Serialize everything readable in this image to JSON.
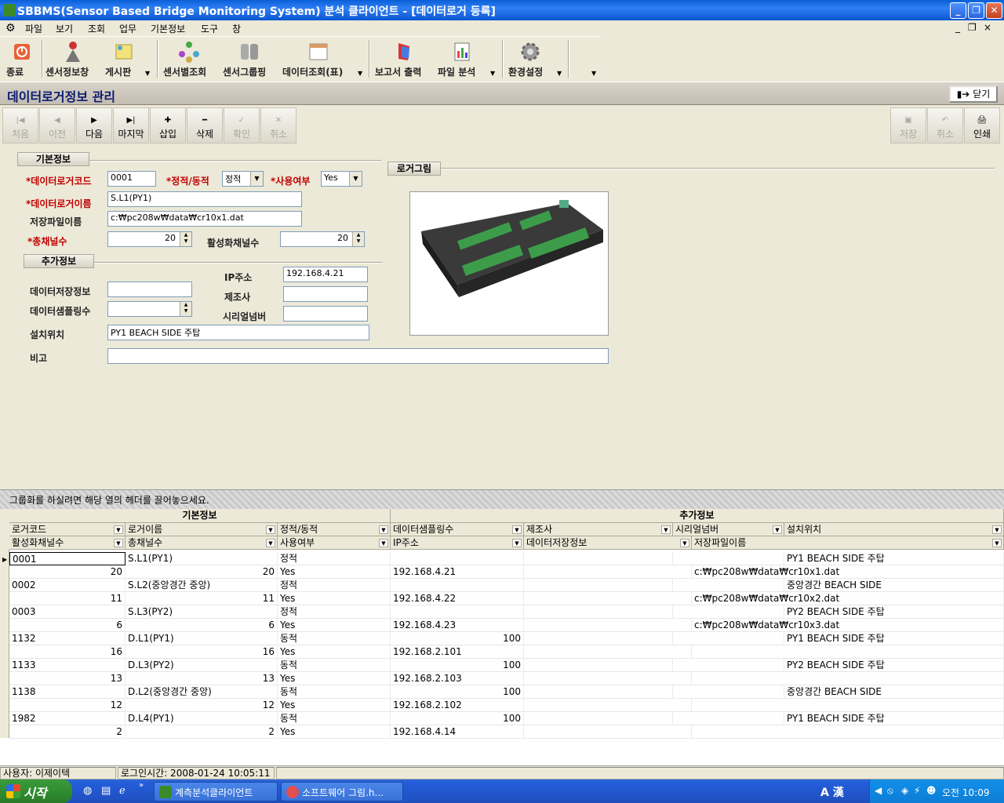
{
  "window": {
    "title": "SBBMS(Sensor Based Bridge Monitoring System) 분석 클라이언트 - [데이터로거 등록]",
    "min": "_",
    "max": "❐",
    "close": "✕"
  },
  "menu": [
    "파일",
    "보기",
    "조회",
    "업무",
    "기본정보",
    "도구",
    "창"
  ],
  "mdi_controls": [
    "_",
    "❐",
    "×"
  ],
  "toolbar": {
    "exit": "종료",
    "sensor_info": "센서정보창",
    "board": "게시판",
    "sensor_query": "센서별조회",
    "sensor_group": "센서그룹핑",
    "data_query": "데이터조회(표)",
    "report": "보고서 출력",
    "file_analysis": "파일 분석",
    "settings": "환경설정"
  },
  "form": {
    "title": "데이터로거정보 관리",
    "close_label": "닫기"
  },
  "nav": {
    "first": "처음",
    "prev": "이전",
    "next": "다음",
    "last": "마지막",
    "insert": "삽입",
    "delete": "삭제",
    "confirm": "확인",
    "cancel": "취소",
    "save": "저장",
    "cancel2": "취소",
    "print": "인쇄"
  },
  "sections": {
    "basic": "기본정보",
    "extra": "추가정보",
    "photo": "로거그림"
  },
  "labels": {
    "logger_code": "*데이터로거코드",
    "static_dynamic": "*정적/동적",
    "in_use": "*사용여부",
    "logger_name": "*데이터로거이름",
    "save_file": "저장파일이름",
    "total_channels": "*총채널수",
    "active_channels": "활성화채널수",
    "ip": "IP주소",
    "data_store": "데이터저장정보",
    "maker": "제조사",
    "sampling": "데이터샘플링수",
    "serial": "시리얼넘버",
    "location": "설치위치",
    "remark": "비고"
  },
  "values": {
    "logger_code": "0001",
    "static_dynamic": "정적",
    "in_use": "Yes",
    "logger_name": "S.L1(PY1)",
    "save_file": "c:₩pc208w₩data₩cr10x1.dat",
    "total_channels": "20",
    "active_channels": "20",
    "ip": "192.168.4.21",
    "data_store": "",
    "maker": "",
    "sampling": "",
    "serial": "",
    "location": "PY1 BEACH SIDE 주탑",
    "remark": ""
  },
  "grid": {
    "group_hint": "그룹화를 하실려면 해당 열의 헤더를 끌어놓으세요.",
    "bands": [
      "기본정보",
      "추가정보"
    ],
    "header1": [
      "로거코드",
      "로거이름",
      "정적/동적",
      "데이터샘플링수",
      "제조사",
      "시리얼넘버",
      "설치위치"
    ],
    "header2": [
      "활성화채널수",
      "총채널수",
      "사용여부",
      "IP주소",
      "데이터저장정보",
      "저장파일이름"
    ],
    "rows": [
      {
        "code": "0001",
        "name": "S.L1(PY1)",
        "type": "정적",
        "sampling": "",
        "location": "PY1 BEACH SIDE 주탑",
        "active": "20",
        "total": "20",
        "use": "Yes",
        "ip": "192.168.4.21",
        "file": "c:₩pc208w₩data₩cr10x1.dat"
      },
      {
        "code": "0002",
        "name": "S.L2(중앙경간 중앙)",
        "type": "정적",
        "sampling": "",
        "location": "중앙경간 BEACH SIDE",
        "active": "11",
        "total": "11",
        "use": "Yes",
        "ip": "192.168.4.22",
        "file": "c:₩pc208w₩data₩cr10x2.dat"
      },
      {
        "code": "0003",
        "name": "S.L3(PY2)",
        "type": "정적",
        "sampling": "",
        "location": "PY2 BEACH SIDE 주탑",
        "active": "6",
        "total": "6",
        "use": "Yes",
        "ip": "192.168.4.23",
        "file": "c:₩pc208w₩data₩cr10x3.dat"
      },
      {
        "code": "1132",
        "name": "D.L1(PY1)",
        "type": "동적",
        "sampling": "100",
        "location": "PY1 BEACH SIDE 주탑",
        "active": "16",
        "total": "16",
        "use": "Yes",
        "ip": "192.168.2.101",
        "file": ""
      },
      {
        "code": "1133",
        "name": "D.L3(PY2)",
        "type": "동적",
        "sampling": "100",
        "location": "PY2 BEACH SIDE 주탑",
        "active": "13",
        "total": "13",
        "use": "Yes",
        "ip": "192.168.2.103",
        "file": ""
      },
      {
        "code": "1138",
        "name": "D.L2(중앙경간 중앙)",
        "type": "동적",
        "sampling": "100",
        "location": "중앙경간 BEACH SIDE",
        "active": "12",
        "total": "12",
        "use": "Yes",
        "ip": "192.168.2.102",
        "file": ""
      },
      {
        "code": "1982",
        "name": "D.L4(PY1)",
        "type": "동적",
        "sampling": "100",
        "location": "PY1 BEACH SIDE 주탑",
        "active": "2",
        "total": "2",
        "use": "Yes",
        "ip": "192.168.4.14",
        "file": ""
      }
    ]
  },
  "status": {
    "user": "사용자: 이제이텍",
    "login": "로그인시간: 2008-01-24 10:05:11"
  },
  "taskbar": {
    "start": "시작",
    "tasks": [
      "계측분석클라이언트",
      "소프트웨어 그림.h..."
    ],
    "ime": "A 漢",
    "clock": "오전 10:09"
  }
}
